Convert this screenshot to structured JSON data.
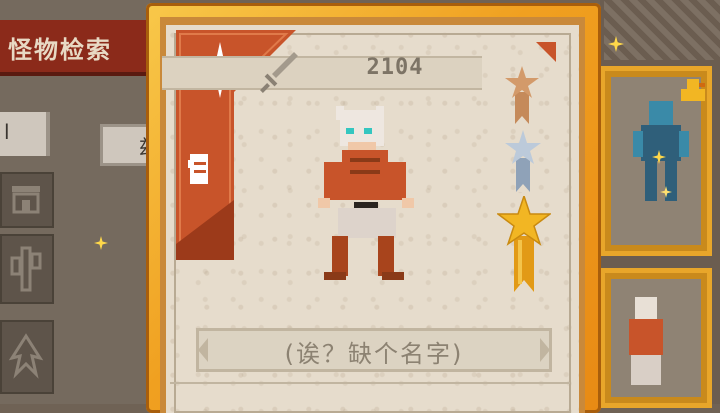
{
  "background": {
    "title": "怪物检索",
    "tab_left": "l",
    "tab_2": "兹"
  },
  "card": {
    "number": "2104",
    "monster_name": "(诶？缺个名字)",
    "rarity_icon": "sparkle-star-icon",
    "type_icon": "fist-icon",
    "weapon_icon": "sword-icon"
  },
  "medals": [
    {
      "tier": "bronze",
      "color": "#d39a6a"
    },
    {
      "tier": "silver",
      "color": "#a9b8c8"
    },
    {
      "tier": "gold",
      "color": "#f2b623"
    }
  ],
  "colors": {
    "card_gold": "#f0a020",
    "rarity_red": "#c8542a",
    "parchment": "#e6dccc"
  }
}
